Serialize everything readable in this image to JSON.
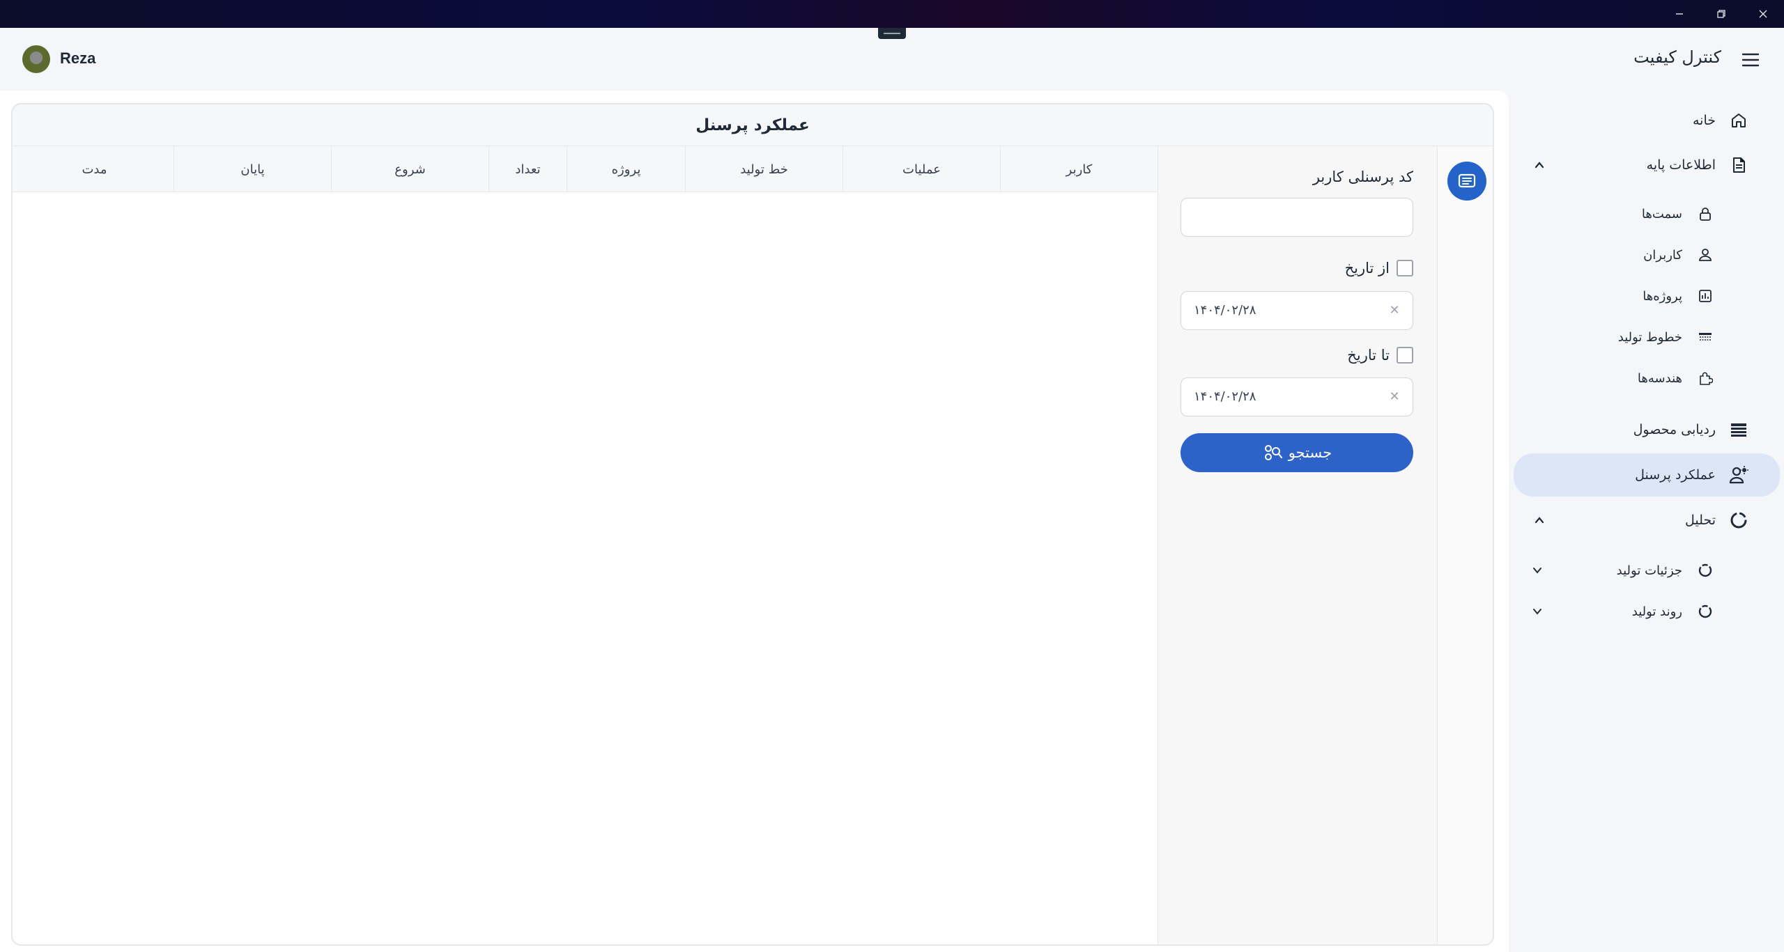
{
  "header": {
    "username": "Reza",
    "app_title": "کنترل کیفیت"
  },
  "sidebar": {
    "items": [
      {
        "label": "خانه",
        "icon": "home-icon"
      },
      {
        "label": "اطلاعات پایه",
        "icon": "document-icon",
        "expanded": true
      },
      {
        "label": "سمت‌ها",
        "icon": "lock-icon"
      },
      {
        "label": "کاربران",
        "icon": "user-icon"
      },
      {
        "label": "پروژه‌ها",
        "icon": "bar-chart-icon"
      },
      {
        "label": "خطوط تولید",
        "icon": "production-line-icon"
      },
      {
        "label": "هندسه‌ها",
        "icon": "puzzle-icon"
      },
      {
        "label": "ردیابی محصول",
        "icon": "list-icon"
      },
      {
        "label": "عملکرد پرسنل",
        "icon": "user-settings-icon",
        "active": true
      },
      {
        "label": "تحلیل",
        "icon": "donut-icon",
        "expanded": true
      },
      {
        "label": "جزئیات تولید",
        "icon": "circle-icon"
      },
      {
        "label": "روند تولید",
        "icon": "circle-icon"
      }
    ]
  },
  "page": {
    "title": "عملکرد پرسنل"
  },
  "filters": {
    "user_code_label": "کد پرسنلی کاربر",
    "user_code_value": "",
    "from_date_label": "از تاریخ",
    "from_date_value": "۱۴۰۴/۰۲/۲۸",
    "to_date_label": "تا تاریخ",
    "to_date_value": "۱۴۰۴/۰۲/۲۸",
    "search_label": "جستجو"
  },
  "table": {
    "columns": [
      "کاربر",
      "عملیات",
      "خط تولید",
      "پروژه",
      "تعداد",
      "شروع",
      "پایان",
      "مدت"
    ],
    "rows": []
  },
  "colors": {
    "accent": "#2d63c8",
    "active_nav": "#dde6f7"
  }
}
